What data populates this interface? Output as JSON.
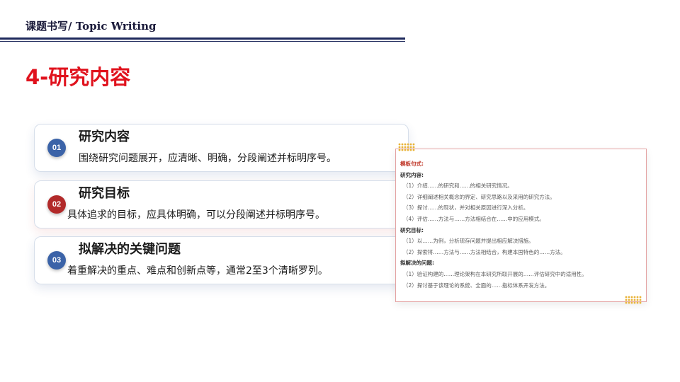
{
  "header": {
    "title": "课题书写/ Topic Writing"
  },
  "page": {
    "title": "4-研究内容"
  },
  "cards": [
    {
      "number": "01",
      "title": "研究内容",
      "description": "围绕研究问题展开，应清晰、明确，分段阐述并标明序号。",
      "badge_color": "#3b63a8"
    },
    {
      "number": "02",
      "title": "研究目标",
      "description": "具体追求的目标，应具体明确，可以分段阐述并标明序号。",
      "badge_color": "#b22a2a"
    },
    {
      "number": "03",
      "title": "拟解决的关键问题",
      "description": "着重解决的重点、难点和创新点等，通常2至3个清晰罗列。",
      "badge_color": "#3b63a8"
    }
  ],
  "template": {
    "heading": "模板句式:",
    "sections": [
      {
        "title": "研究内容:",
        "items": [
          "（1）介绍……的研究和……的相关研究情况。",
          "（2）详细阐述相关概念的界定、研究思路以及采用的研究方法。",
          "（3）探讨……的现状，并对相关原因进行深入分析。",
          "（4）评估……方法与……方法相结合在……中的应用模式。"
        ]
      },
      {
        "title": "研究目标:",
        "items": [
          "（1）以……为例，分析现存问题并提出相应解决措施。",
          "（2）探索将……方法与……方法相结合，构建本国特色的……方法。"
        ]
      },
      {
        "title": "拟解决的问题:",
        "items": [
          "（1）验证构建的……理论架构在本研究所取开展的……评估研究中的适用性。",
          "（2）探讨基于该理论的系统、全面的……指标体系开发方法。"
        ]
      }
    ]
  },
  "colors": {
    "title_red": "#e0121d",
    "rule_navy": "#1f2a5c",
    "template_border": "#e4a3a3",
    "dot_gold": "#e9b43a"
  }
}
